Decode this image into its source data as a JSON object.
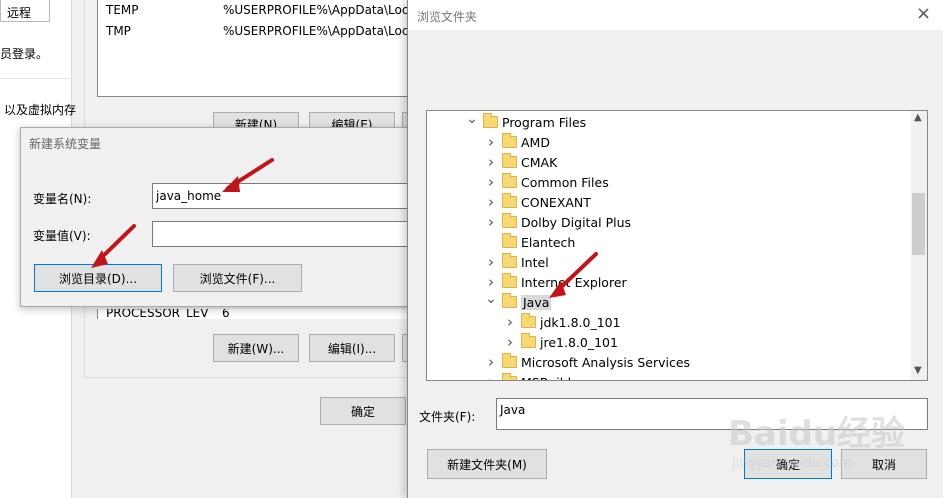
{
  "system_properties": {
    "tab_label": "远程",
    "text_line1": "员登录。",
    "text_line2": "以及虚拟内存"
  },
  "env_vars": {
    "rows_top": [
      {
        "name": "TEMP",
        "value": "%USERPROFILE%\\AppData\\Loca"
      },
      {
        "name": "TMP",
        "value": "%USERPROFILE%\\AppData\\Loca"
      }
    ],
    "user_new_label": "新建(N)",
    "user_edit_label": "编辑(E)",
    "row_bottom": {
      "name": "PROCESSOR_LEV",
      "value": "6"
    },
    "sys_new_label": "新建(W)...",
    "sys_edit_label": "编辑(I)...",
    "ok_label": "确定"
  },
  "new_var_dialog": {
    "title": "新建系统变量",
    "name_label": "变量名(N):",
    "name_value": "java_home",
    "value_label": "变量值(V):",
    "value_value": "",
    "browse_dir_label": "浏览目录(D)...",
    "browse_file_label": "浏览文件(F)..."
  },
  "browse_dialog": {
    "title": "浏览文件夹",
    "close_glyph": "×",
    "tree": [
      {
        "label": "Program Files",
        "level": 0,
        "expanded": true
      },
      {
        "label": "AMD",
        "level": 1,
        "expanded": false
      },
      {
        "label": "CMAK",
        "level": 1,
        "expanded": false
      },
      {
        "label": "Common Files",
        "level": 1,
        "expanded": false
      },
      {
        "label": "CONEXANT",
        "level": 1,
        "expanded": false
      },
      {
        "label": "Dolby Digital Plus",
        "level": 1,
        "expanded": false
      },
      {
        "label": "Elantech",
        "level": 1,
        "expanded": null
      },
      {
        "label": "Intel",
        "level": 1,
        "expanded": false
      },
      {
        "label": "Internet Explorer",
        "level": 1,
        "expanded": false
      },
      {
        "label": "Java",
        "level": 1,
        "expanded": true,
        "selected": true
      },
      {
        "label": "jdk1.8.0_101",
        "level": 2,
        "expanded": false
      },
      {
        "label": "jre1.8.0_101",
        "level": 2,
        "expanded": false
      },
      {
        "label": "Microsoft Analysis Services",
        "level": 1,
        "expanded": false
      },
      {
        "label": "MSBuild",
        "level": 1,
        "expanded": false
      }
    ],
    "folder_label": "文件夹(F):",
    "folder_value": "Java",
    "new_folder_label": "新建文件夹(M)",
    "ok_label": "确定",
    "cancel_label": "取消"
  },
  "watermark": {
    "brand": "Baidu经验",
    "url": "jingyan.baidu.com"
  },
  "colors": {
    "annotation_arrow": "#c0151b",
    "focus_border": "#0078d7",
    "folder": "#f8d775"
  }
}
